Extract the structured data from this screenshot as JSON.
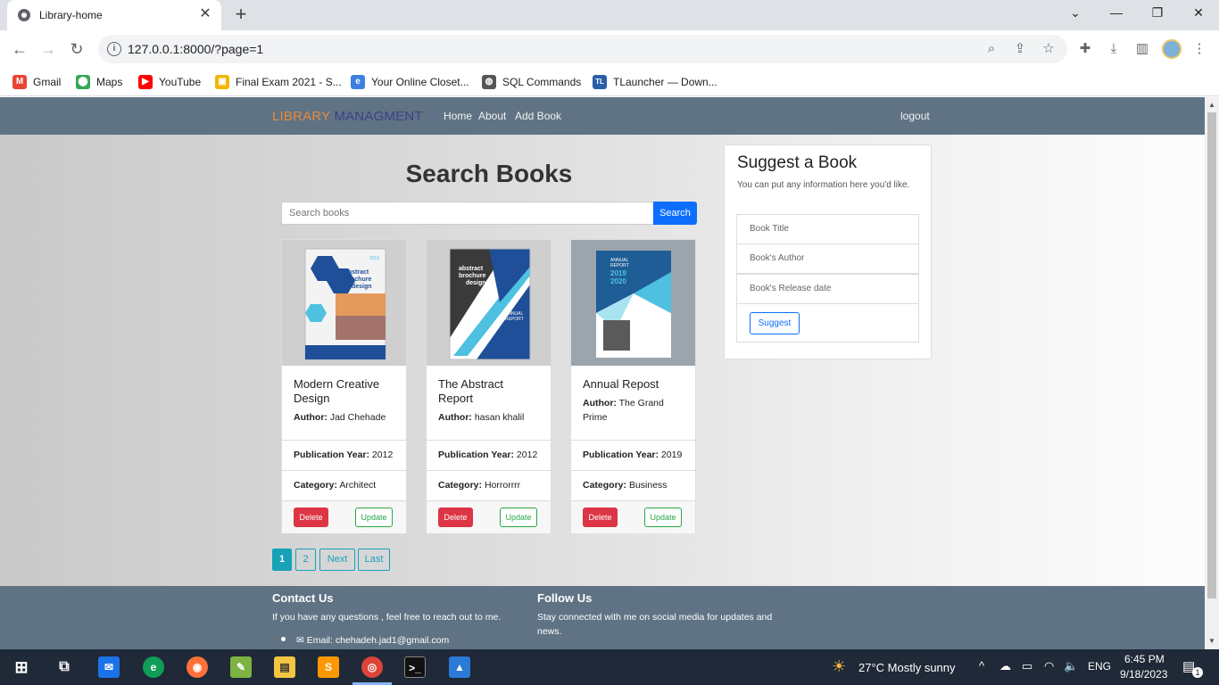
{
  "browser": {
    "tab_title": "Library-home",
    "tab_close": "✕",
    "new_tab": "+",
    "url": "127.0.0.1:8000/?page=1",
    "bookmarks": [
      {
        "label": "Gmail",
        "color": "#ea4335",
        "glyph": "M"
      },
      {
        "label": "Maps",
        "color": "#34a853",
        "glyph": "⬤"
      },
      {
        "label": "YouTube",
        "color": "#ff0000",
        "glyph": "▶"
      },
      {
        "label": "Final Exam 2021 - S...",
        "color": "#f4b400",
        "glyph": "▣"
      },
      {
        "label": "Your Online Closet...",
        "color": "#3f7fe0",
        "glyph": "e"
      },
      {
        "label": "SQL Commands",
        "color": "#555555",
        "glyph": "◍"
      },
      {
        "label": "TLauncher — Down...",
        "color": "#2a5ea8",
        "glyph": "TL"
      }
    ]
  },
  "site": {
    "brand_part1": "LIBRARY",
    "brand_part2": "MANAGMENT",
    "nav": [
      "Home",
      "About",
      "Add Book"
    ],
    "logout": "logout",
    "search_title": "Search Books",
    "search_placeholder": "Search books",
    "search_button": "Search",
    "labels": {
      "author": "Author:",
      "year": "Publication Year:",
      "category": "Category:",
      "delete": "Delete",
      "update": "Update"
    },
    "books": [
      {
        "title": "Modern Creative Design",
        "author": "Jad Chehade",
        "year": "2012",
        "category": "Architect"
      },
      {
        "title": "The Abstract Report",
        "author": "hasan khalil",
        "year": "2012",
        "category": "Horrorrrr"
      },
      {
        "title": "Annual Repost",
        "author": "The Grand Prime",
        "year": "2019",
        "category": "Business"
      }
    ],
    "pagination": [
      "1",
      "2",
      "Next",
      "Last"
    ],
    "suggest": {
      "title": "Suggest a Book",
      "description": "You can put any information here you'd like.",
      "fields": [
        "Book Title",
        "Book's Author",
        "Book's Release date"
      ],
      "button": "Suggest"
    },
    "footer": {
      "contact_title": "Contact Us",
      "contact_text": "If you have any questions , feel free to reach out to me.",
      "email": "Email: chehadeh.jad1@gmail.com",
      "follow_title": "Follow Us",
      "follow_text": "Stay connected with me on social media for updates and news."
    }
  },
  "taskbar": {
    "weather": "27°C  Mostly sunny",
    "lang": "ENG",
    "time": "6:45 PM",
    "date": "9/18/2023",
    "notifications": "1"
  }
}
